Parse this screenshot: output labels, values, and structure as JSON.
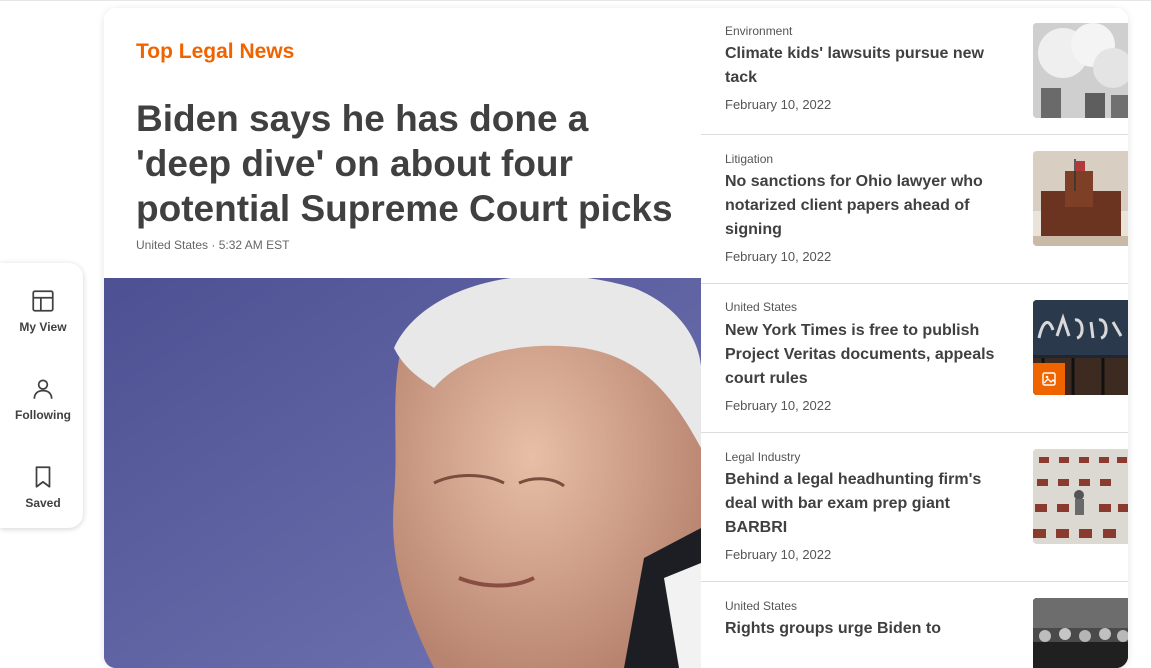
{
  "sidebar": {
    "items": [
      {
        "label": "My View",
        "icon": "layout-icon"
      },
      {
        "label": "Following",
        "icon": "person-icon"
      },
      {
        "label": "Saved",
        "icon": "bookmark-icon"
      }
    ]
  },
  "lead": {
    "section_title": "Top Legal News",
    "headline": "Biden says he has done a 'deep dive' on about four potential Supreme Court picks",
    "meta": "United States · 5:32 AM EST"
  },
  "stories": [
    {
      "kicker": "Environment",
      "title": "Climate kids' lawsuits pursue new tack",
      "date": "February 10, 2022"
    },
    {
      "kicker": "Litigation",
      "title": "No sanctions for Ohio lawyer who notarized client papers ahead of signing",
      "date": "February 10, 2022"
    },
    {
      "kicker": "United States",
      "title": "New York Times is free to publish Project Veritas documents, appeals court rules",
      "date": "February 10, 2022"
    },
    {
      "kicker": "Legal Industry",
      "title": "Behind a legal headhunting firm's deal with bar exam prep giant BARBRI",
      "date": "February 10, 2022"
    },
    {
      "kicker": "United States",
      "title": "Rights groups urge Biden to",
      "date": ""
    }
  ],
  "colors": {
    "accent": "#f06400",
    "text": "#404040"
  }
}
